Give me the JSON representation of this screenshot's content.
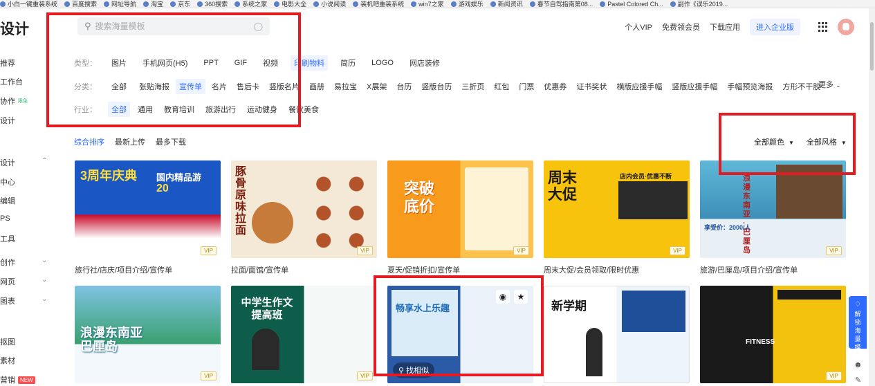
{
  "bookmarks": [
    "小白一键重装系统",
    "百度搜索",
    "网址导航",
    "淘宝",
    "京东",
    "360搜索",
    "系统之家",
    "电影大全",
    "小说阅读",
    "装机吧重装系统",
    "win7之家",
    "游戏娱乐",
    "新闻资讯",
    "春节自驾指南第08...",
    "Pastel Colored Ch...",
    "副作《误乐2019..."
  ],
  "header": {
    "logo": "设计",
    "search_placeholder": "搜索海量模板",
    "links": [
      "个人VIP",
      "免费领会员",
      "下载应用"
    ],
    "enterprise": "进入企业版"
  },
  "sidebar": {
    "items": [
      {
        "label": "推荐"
      },
      {
        "label": "工作台"
      },
      {
        "label": "协作",
        "badge": "限免"
      },
      {
        "label": "设计"
      },
      {
        "label": "设计"
      },
      {
        "label": "中心"
      },
      {
        "label": "编辑"
      },
      {
        "label": "PS"
      },
      {
        "label": "工具"
      },
      {
        "label": "创作"
      },
      {
        "label": "网页"
      },
      {
        "label": "图表"
      },
      {
        "label": "抠图"
      },
      {
        "label": "素材"
      },
      {
        "label": "营销",
        "badge": "NEW"
      }
    ]
  },
  "filters": {
    "type_label": "类型：",
    "types": [
      "图片",
      "手机网页(H5)",
      "PPT",
      "GIF",
      "视频",
      "印刷物料",
      "简历",
      "LOGO",
      "网店装修"
    ],
    "category_label": "分类：",
    "categories": [
      "全部",
      "张贴海报",
      "宣传单",
      "名片",
      "售后卡",
      "竖版名片",
      "画册",
      "易拉宝",
      "X展架",
      "台历",
      "竖版台历",
      "三折页",
      "红包",
      "门票",
      "优惠券",
      "证书奖状",
      "横版应援手幅",
      "竖版应援手幅",
      "手幅预览海报",
      "方形不干胶"
    ],
    "more": "更多",
    "industry_label": "行业：",
    "industries": [
      "全部",
      "通用",
      "教育培训",
      "旅游出行",
      "运动健身",
      "餐饮美食"
    ]
  },
  "sort": {
    "options": [
      "综合排序",
      "最新上传",
      "最多下载"
    ]
  },
  "dropdowns": {
    "color": "全部颜色",
    "style": "全部风格"
  },
  "cards": [
    {
      "title": "旅行社/店庆/项目介绍/宣传单",
      "text_a": "3周年庆典",
      "text_b": "国内精品游",
      "text_c": "20"
    },
    {
      "title": "拉面/面馆/宣传单",
      "text_a": "豚骨原味拉面"
    },
    {
      "title": "夏天/促销折扣/宣传单",
      "text_a": "突破底价"
    },
    {
      "title": "周末大促/会员领取/限时优惠",
      "text_a": "周末大促",
      "text_b": "店内会员·优惠不断"
    },
    {
      "title": "旅游/巴厘岛/项目介绍/宣传单",
      "text_a": "浪漫东南亚·巴厘岛",
      "text_b": "享受价：2000/人"
    },
    {
      "title": "",
      "text_a": "浪漫东南亚巴厘岛"
    },
    {
      "title": "",
      "text_a": "中学生作文提高班"
    },
    {
      "title": "",
      "text_a": "畅享水上乐趣",
      "similar": "找相似"
    },
    {
      "title": "",
      "text_a": "新学期"
    },
    {
      "title": "",
      "text_a": "FITNESS"
    }
  ],
  "vip_label": "VIP",
  "float_panel": "解锁海量模板"
}
